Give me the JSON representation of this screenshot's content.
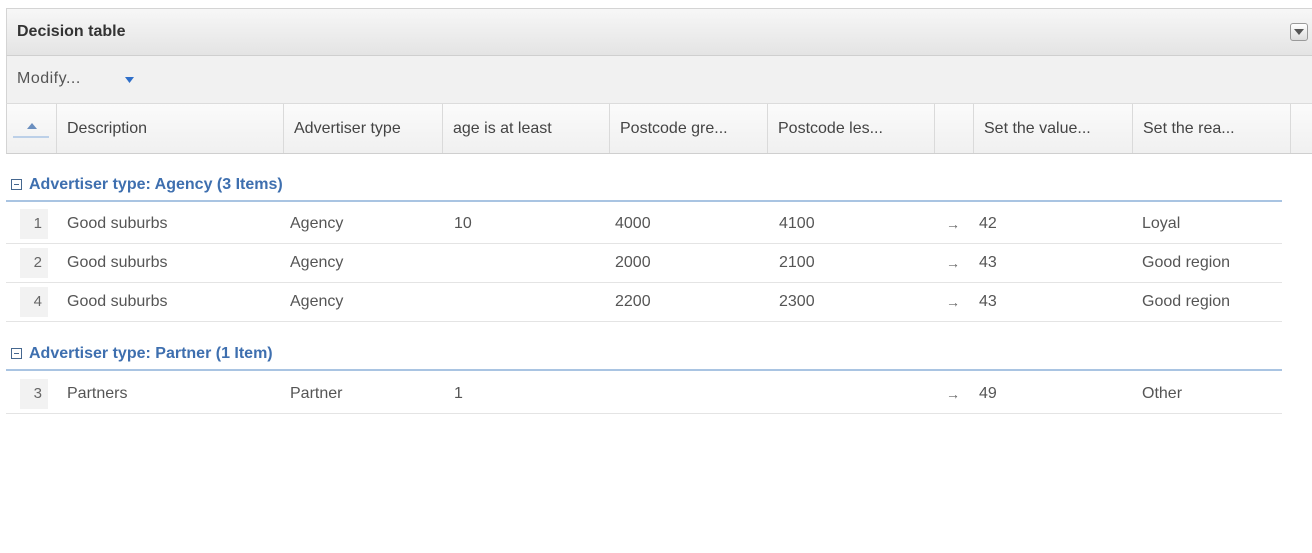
{
  "panel": {
    "title": "Decision table"
  },
  "toolbar": {
    "modify_label": "Modify..."
  },
  "columns": [
    "Description",
    "Advertiser type",
    "age is at least",
    "Postcode gre...",
    "Postcode les...",
    "",
    "Set the value...",
    "Set the rea..."
  ],
  "groups": [
    {
      "label": "Advertiser type: Agency (3 Items)",
      "rows": [
        {
          "num": "1",
          "description": "Good suburbs",
          "advertiser_type": "Agency",
          "age": "10",
          "postcode_gte": "4000",
          "postcode_lt": "4100",
          "arrow": "→",
          "value": "42",
          "reason": "Loyal"
        },
        {
          "num": "2",
          "description": "Good suburbs",
          "advertiser_type": "Agency",
          "age": "",
          "postcode_gte": "2000",
          "postcode_lt": "2100",
          "arrow": "→",
          "value": "43",
          "reason": "Good region"
        },
        {
          "num": "4",
          "description": "Good suburbs",
          "advertiser_type": "Agency",
          "age": "",
          "postcode_gte": "2200",
          "postcode_lt": "2300",
          "arrow": "→",
          "value": "43",
          "reason": "Good region"
        }
      ]
    },
    {
      "label": "Advertiser type: Partner (1 Item)",
      "rows": [
        {
          "num": "3",
          "description": "Partners",
          "advertiser_type": "Partner",
          "age": "1",
          "postcode_gte": "",
          "postcode_lt": "",
          "arrow": "→",
          "value": "49",
          "reason": "Other"
        }
      ]
    }
  ],
  "icons": {
    "collapse_panel": "chevron-down-icon",
    "modify_dropdown": "caret-down-icon",
    "sort": "sort-ascending-icon",
    "group_toggle": "minus-box-icon",
    "action_arrow": "right-arrow"
  },
  "colors": {
    "group_label": "#3e6faf",
    "group_line": "#a9c4e2",
    "accent": "#3a75c4"
  }
}
